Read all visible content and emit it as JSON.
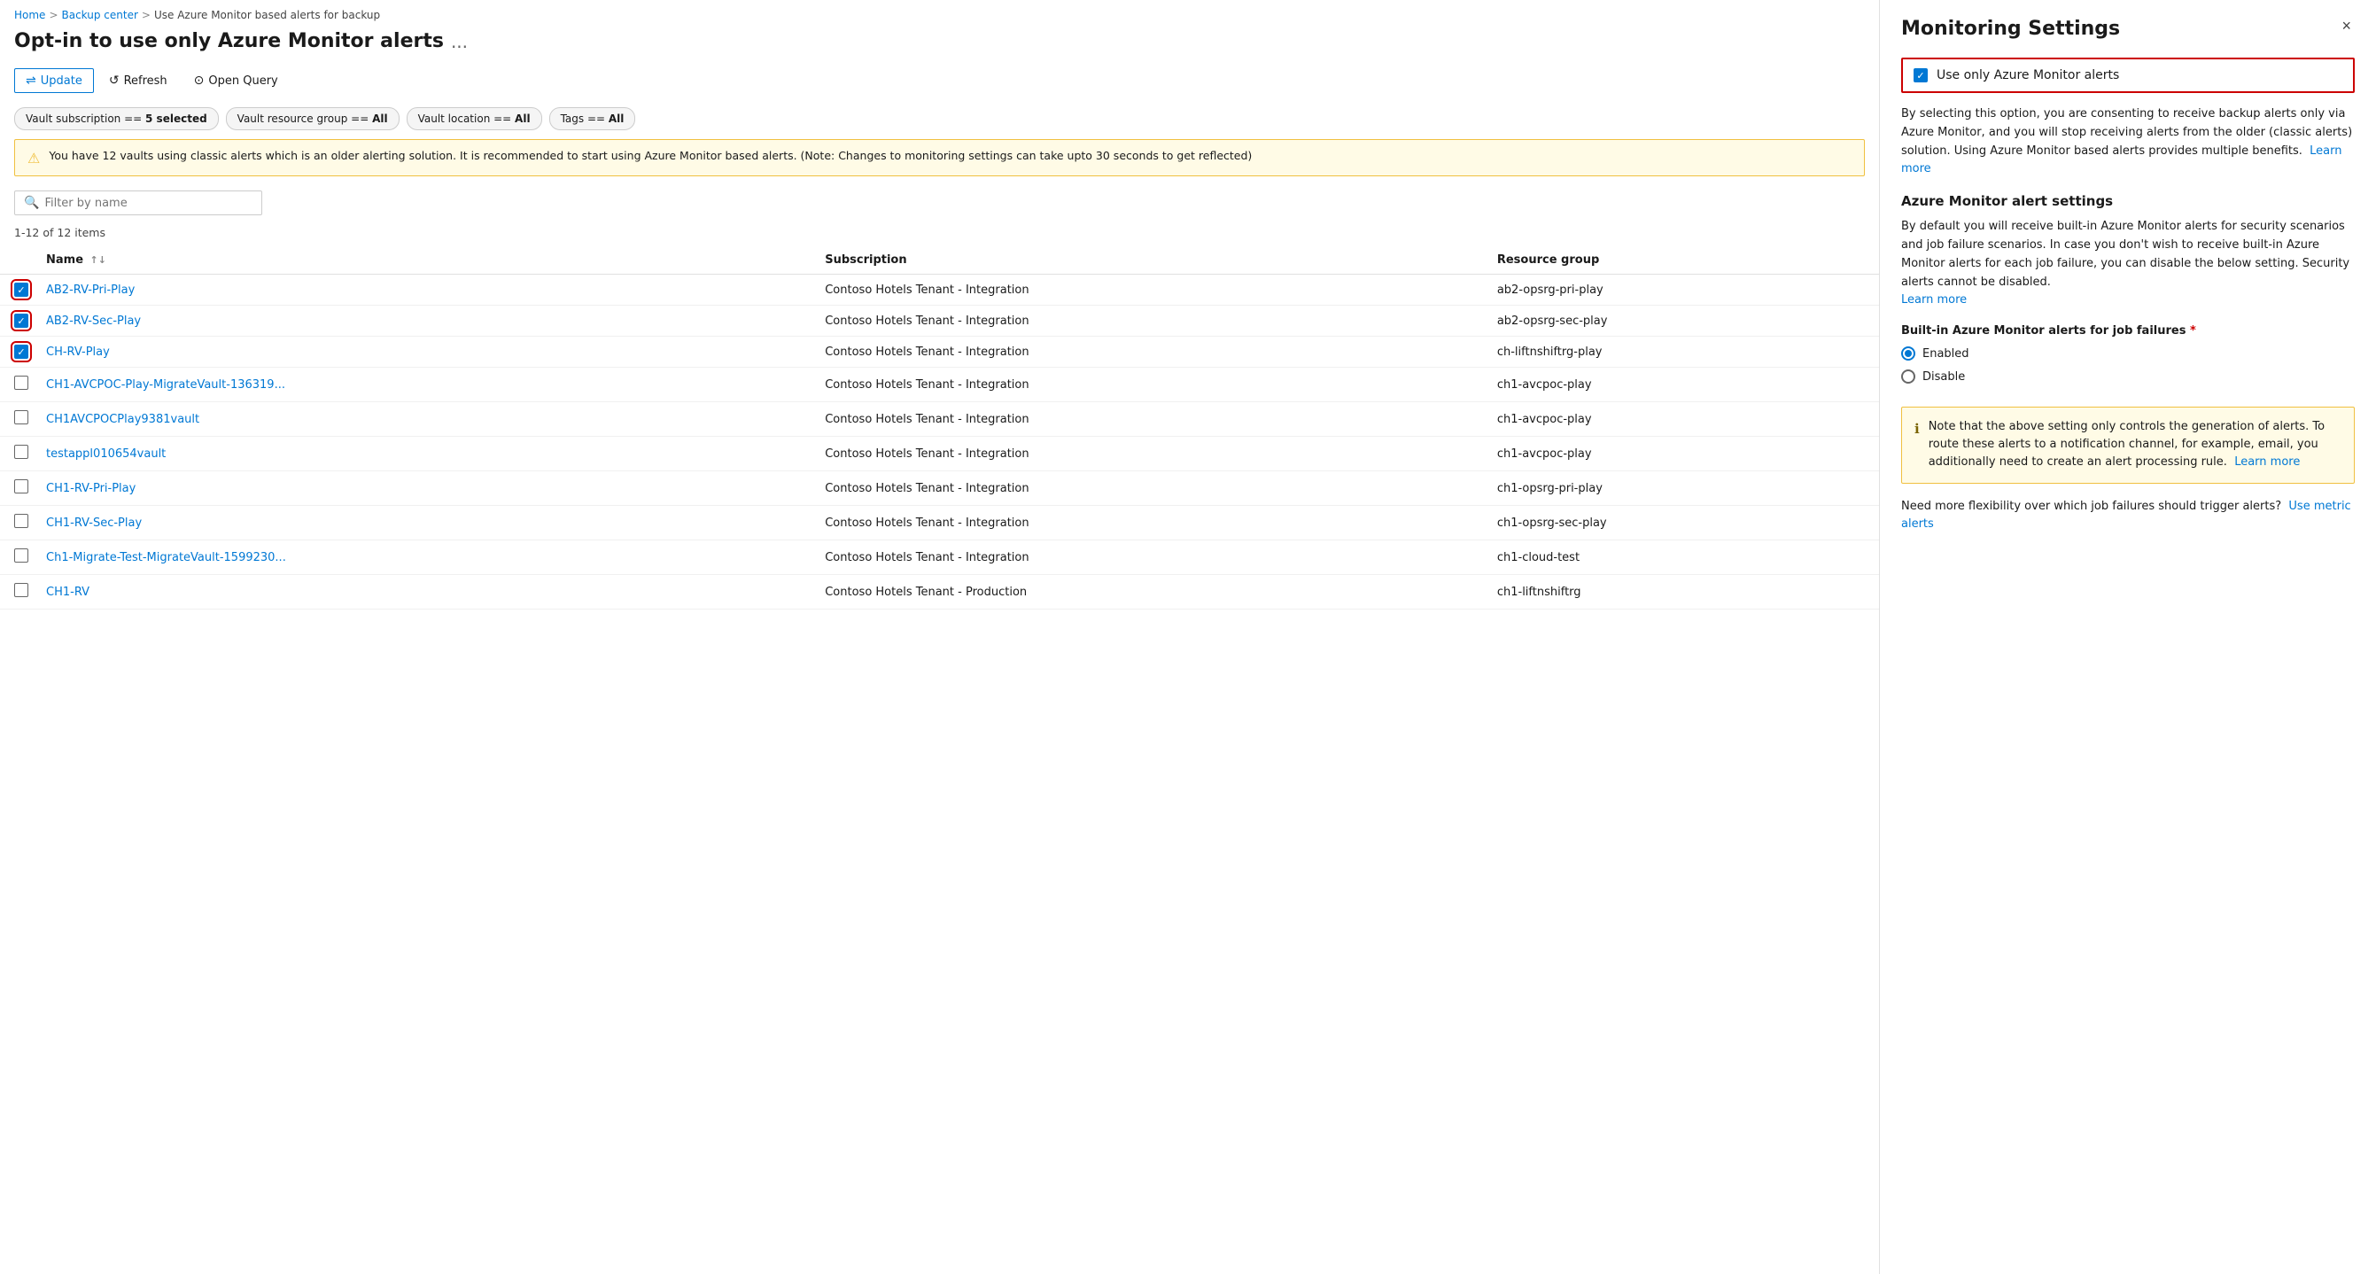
{
  "breadcrumb": {
    "home": "Home",
    "backup_center": "Backup center",
    "current": "Use Azure Monitor based alerts for backup",
    "sep": ">"
  },
  "page": {
    "title": "Opt-in to use only Azure Monitor alerts",
    "more_icon": "..."
  },
  "toolbar": {
    "update_label": "Update",
    "refresh_label": "Refresh",
    "open_query_label": "Open Query"
  },
  "filters": [
    {
      "label": "Vault subscription == 5 selected"
    },
    {
      "label": "Vault resource group == All"
    },
    {
      "label": "Vault location == All"
    },
    {
      "label": "Tags == All"
    }
  ],
  "warning": {
    "text": "You have 12 vaults using classic alerts which is an older alerting solution. It is recommended to start using Azure Monitor based alerts. (Note: Changes to monitoring settings can take upto 30 seconds to get reflected)"
  },
  "search": {
    "placeholder": "Filter by name"
  },
  "items_count": "1-12 of 12 items",
  "table": {
    "columns": [
      {
        "label": "",
        "sortable": false
      },
      {
        "label": "Name",
        "sortable": true
      },
      {
        "label": "Subscription",
        "sortable": false
      },
      {
        "label": "Resource group",
        "sortable": false
      }
    ],
    "rows": [
      {
        "checked": true,
        "red_border": true,
        "name": "AB2-RV-Pri-Play",
        "subscription": "Contoso Hotels Tenant - Integration",
        "resource_group": "ab2-opsrg-pri-play"
      },
      {
        "checked": true,
        "red_border": true,
        "name": "AB2-RV-Sec-Play",
        "subscription": "Contoso Hotels Tenant - Integration",
        "resource_group": "ab2-opsrg-sec-play"
      },
      {
        "checked": true,
        "red_border": true,
        "name": "CH-RV-Play",
        "subscription": "Contoso Hotels Tenant - Integration",
        "resource_group": "ch-liftnshiftrg-play"
      },
      {
        "checked": false,
        "red_border": false,
        "name": "CH1-AVCPOC-Play-MigrateVault-136319...",
        "subscription": "Contoso Hotels Tenant - Integration",
        "resource_group": "ch1-avcpoc-play"
      },
      {
        "checked": false,
        "red_border": false,
        "name": "CH1AVCPOCPlay9381vault",
        "subscription": "Contoso Hotels Tenant - Integration",
        "resource_group": "ch1-avcpoc-play"
      },
      {
        "checked": false,
        "red_border": false,
        "name": "testappl010654vault",
        "subscription": "Contoso Hotels Tenant - Integration",
        "resource_group": "ch1-avcpoc-play"
      },
      {
        "checked": false,
        "red_border": false,
        "name": "CH1-RV-Pri-Play",
        "subscription": "Contoso Hotels Tenant - Integration",
        "resource_group": "ch1-opsrg-pri-play"
      },
      {
        "checked": false,
        "red_border": false,
        "name": "CH1-RV-Sec-Play",
        "subscription": "Contoso Hotels Tenant - Integration",
        "resource_group": "ch1-opsrg-sec-play"
      },
      {
        "checked": false,
        "red_border": false,
        "name": "Ch1-Migrate-Test-MigrateVault-1599230...",
        "subscription": "Contoso Hotels Tenant - Integration",
        "resource_group": "ch1-cloud-test"
      },
      {
        "checked": false,
        "red_border": false,
        "name": "CH1-RV",
        "subscription": "Contoso Hotels Tenant - Production",
        "resource_group": "ch1-liftnshiftrg"
      }
    ]
  },
  "right_panel": {
    "title": "Monitoring Settings",
    "close_icon": "×",
    "option_checkbox_label": "Use only Azure Monitor alerts",
    "description": "By selecting this option, you are consenting to receive backup alerts only via Azure Monitor, and you will stop receiving alerts from the older (classic alerts) solution. Using Azure Monitor based alerts provides multiple benefits.",
    "description_learn_more": "Learn more",
    "azure_monitor_heading": "Azure Monitor alert settings",
    "azure_monitor_description": "By default you will receive built-in Azure Monitor alerts for security scenarios and job failure scenarios. In case you don't wish to receive built-in Azure Monitor alerts for each job failure, you can disable the below setting. Security alerts cannot be disabled.",
    "azure_monitor_learn_more": "Learn more",
    "built_in_label": "Built-in Azure Monitor alerts for job failures",
    "built_in_required": "*",
    "radio_enabled": "Enabled",
    "radio_disable": "Disable",
    "info_text": "Note that the above setting only controls the generation of alerts. To route these alerts to a notification channel, for example, email, you additionally need to create an alert processing rule.",
    "info_learn_more": "Learn more",
    "metric_line_prefix": "Need more flexibility over which job failures should trigger alerts?",
    "metric_link": "Use metric alerts"
  }
}
